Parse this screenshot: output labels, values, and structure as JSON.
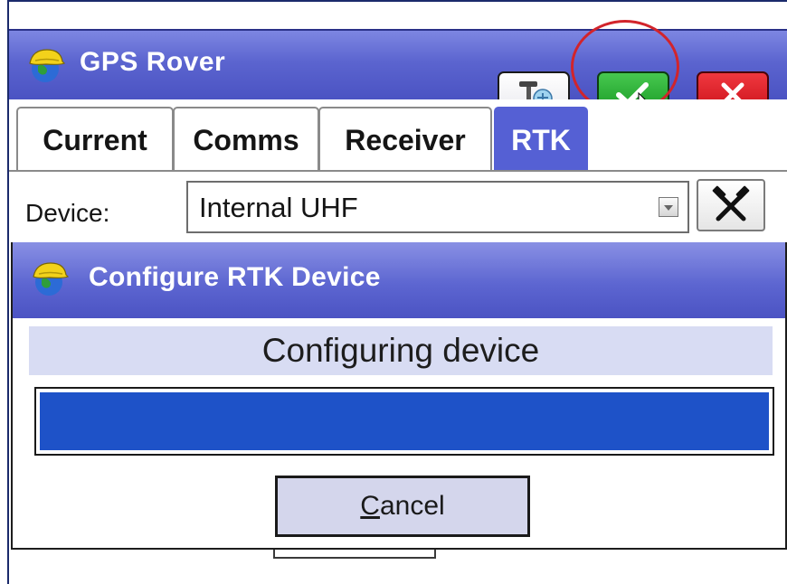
{
  "window": {
    "title": "GPS Rover",
    "toolbar": [
      {
        "name": "antenna-settings-button",
        "icon": "antenna-settings-icon"
      },
      {
        "name": "accept-button",
        "icon": "checkmark-icon",
        "color": "#1aa32a",
        "highlighted": true
      },
      {
        "name": "close-button",
        "icon": "close-icon",
        "color": "#d6141d"
      }
    ]
  },
  "tabs": [
    {
      "label": "Current",
      "active": false
    },
    {
      "label": "Comms",
      "active": false
    },
    {
      "label": "Receiver",
      "active": false
    },
    {
      "label": "RTK",
      "active": true
    }
  ],
  "device": {
    "label": "Device:",
    "value": "Internal UHF",
    "settings_icon": "hammer-icon"
  },
  "dialog": {
    "title": "Configure RTK Device",
    "status": "Configuring device",
    "progress": 1.0,
    "cancel_label": "Cancel",
    "cancel_mnemonic": "C"
  },
  "colors": {
    "title_bar": "#5b64cf",
    "active_tab": "#5560d4",
    "progress_fill": "#1e52c8",
    "highlight_ring": "#d2242b"
  }
}
